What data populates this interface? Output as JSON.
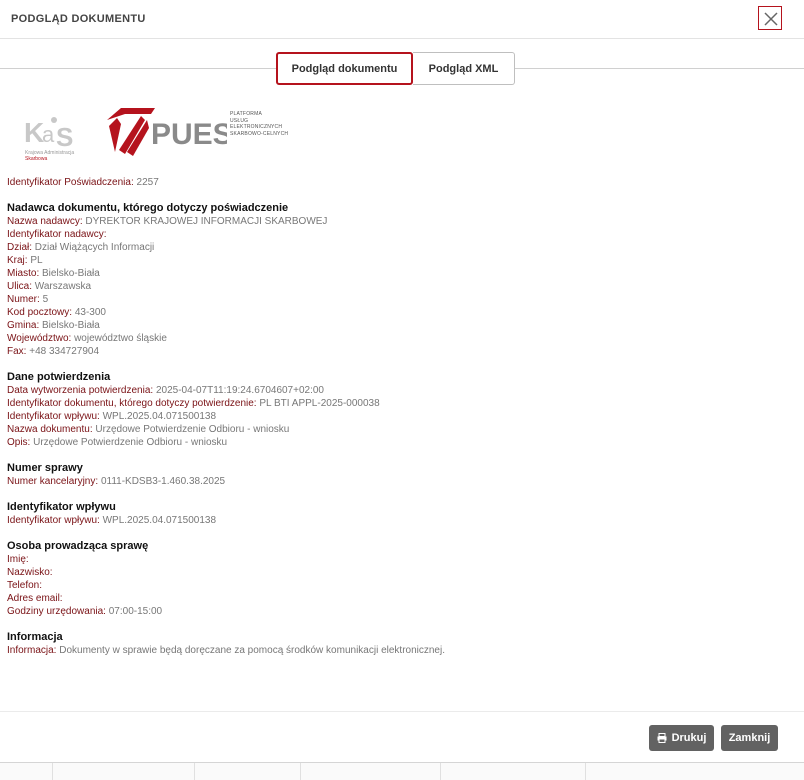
{
  "header": {
    "title": "PODGLĄD DOKUMENTU"
  },
  "tabs": [
    {
      "label": "Podgląd dokumentu",
      "active": true
    },
    {
      "label": "Podgląd XML",
      "active": false
    }
  ],
  "logos": {
    "kas_caption_line1": "Krajowa Administracja",
    "kas_caption_line2": "Skarbowa",
    "puesc_text": "PUESC",
    "puesc_tagline": [
      "PLATFORMA",
      "USŁUG",
      "ELEKTRONICZNYCH",
      "SKARBOWO-CELNYCH"
    ]
  },
  "content": {
    "top": {
      "label": "Identyfikator Poświadczenia:",
      "value": "2257"
    },
    "sections": [
      {
        "title": "Nadawca dokumentu, którego dotyczy poświadczenie",
        "rows": [
          {
            "label": "Nazwa nadawcy:",
            "value": "DYREKTOR KRAJOWEJ INFORMACJI SKARBOWEJ"
          },
          {
            "label": "Identyfikator nadawcy:",
            "value": ""
          },
          {
            "label": "Dział:",
            "value": "Dział Wiążących Informacji"
          },
          {
            "label": "Kraj:",
            "value": "PL"
          },
          {
            "label": "Miasto:",
            "value": "Bielsko-Biała"
          },
          {
            "label": "Ulica:",
            "value": "Warszawska"
          },
          {
            "label": "Numer:",
            "value": "5"
          },
          {
            "label": "Kod pocztowy:",
            "value": "43-300"
          },
          {
            "label": "Gmina:",
            "value": "Bielsko-Biała"
          },
          {
            "label": "Województwo:",
            "value": "województwo śląskie"
          },
          {
            "label": "Fax:",
            "value": "+48 334727904"
          }
        ]
      },
      {
        "title": "Dane potwierdzenia",
        "rows": [
          {
            "label": "Data wytworzenia potwierdzenia:",
            "value": "2025-04-07T11:19:24.6704607+02:00"
          },
          {
            "label": "Identyfikator dokumentu, którego dotyczy potwierdzenie:",
            "value": "PL BTI APPL-2025-000038"
          },
          {
            "label": "Identyfikator wpływu:",
            "value": "WPL.2025.04.071500138"
          },
          {
            "label": "Nazwa dokumentu:",
            "value": "Urzędowe Potwierdzenie Odbioru - wniosku"
          },
          {
            "label": "Opis:",
            "value": "Urzędowe Potwierdzenie Odbioru - wniosku"
          }
        ]
      },
      {
        "title": "Numer sprawy",
        "rows": [
          {
            "label": "Numer kancelaryjny:",
            "value": "0111-KDSB3-1.460.38.2025"
          }
        ]
      },
      {
        "title": "Identyfikator wpływu",
        "rows": [
          {
            "label": "Identyfikator wpływu:",
            "value": "WPL.2025.04.071500138"
          }
        ]
      },
      {
        "title": "Osoba prowadząca sprawę",
        "rows": [
          {
            "label": "Imię:",
            "value": ""
          },
          {
            "label": "Nazwisko:",
            "value": ""
          },
          {
            "label": "Telefon:",
            "value": ""
          },
          {
            "label": "Adres email:",
            "value": ""
          },
          {
            "label": "Godziny urzędowania:",
            "value": "07:00-15:00"
          }
        ]
      },
      {
        "title": "Informacja",
        "rows": [
          {
            "label": "Informacja:",
            "value": "Dokumenty w sprawie będą doręczane za pomocą środków komunikacji elektronicznej."
          }
        ]
      }
    ]
  },
  "footer": {
    "print_label": "Drukuj",
    "close_label": "Zamknij"
  },
  "colors": {
    "accent": "#b5131d",
    "label": "#7a1216",
    "value": "#777777",
    "button": "#626262"
  }
}
